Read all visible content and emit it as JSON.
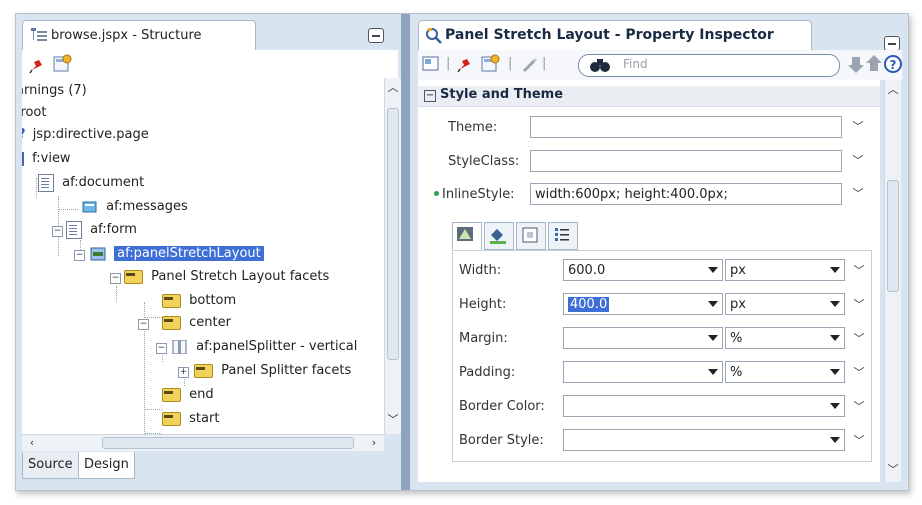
{
  "structure_panel": {
    "tab_title": "browse.jspx - Structure",
    "tree": [
      {
        "label": "arnings (7)"
      },
      {
        "label": ":root"
      },
      {
        "label": "jsp:directive.page"
      },
      {
        "label": "f:view"
      },
      {
        "label": "af:document"
      },
      {
        "label": "af:messages"
      },
      {
        "label": "af:form"
      },
      {
        "label": "af:panelStretchLayout",
        "selected": true
      },
      {
        "label": "Panel Stretch Layout facets"
      },
      {
        "label": "bottom"
      },
      {
        "label": "center"
      },
      {
        "label": "af:panelSplitter - vertical"
      },
      {
        "label": "Panel Splitter facets"
      },
      {
        "label": "end"
      },
      {
        "label": "start"
      }
    ],
    "bottom_tabs": [
      "Source",
      "Design"
    ],
    "active_bottom_tab": "Design"
  },
  "property_inspector": {
    "tab_title": "Panel Stretch Layout - Property Inspector",
    "find_placeholder": "Find",
    "section_title": "Style and Theme",
    "fields": {
      "theme_label": "Theme:",
      "theme_value": "",
      "styleclass_label": "StyleClass:",
      "styleclass_value": "",
      "inlinestyle_label": "InlineStyle:",
      "inlinestyle_value": "width:600px; height:400.0px;"
    },
    "style_props": [
      {
        "label": "Width:",
        "value": "600.0",
        "unit": "px"
      },
      {
        "label": "Height:",
        "value": "400.0",
        "unit": "px",
        "highlighted": true
      },
      {
        "label": "Margin:",
        "value": "",
        "unit": "%"
      },
      {
        "label": "Padding:",
        "value": "",
        "unit": "%"
      },
      {
        "label": "Border Color:",
        "value": ""
      },
      {
        "label": "Border Style:",
        "value": ""
      }
    ]
  },
  "colors": {
    "selection": "#3d6fd6",
    "panel_bg": "#d8e4f0",
    "divider": "#8ea3bd"
  }
}
